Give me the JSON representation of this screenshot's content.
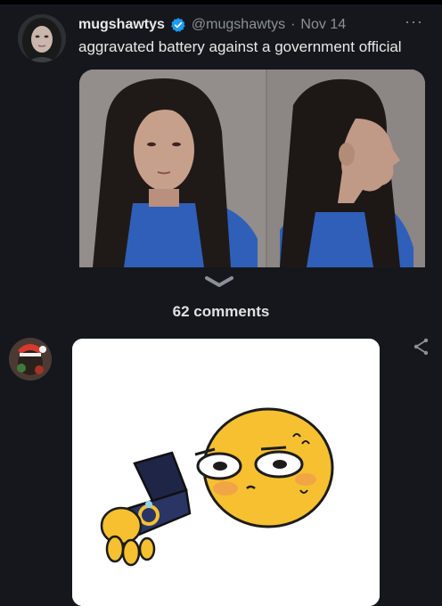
{
  "tweet": {
    "display_name": "mugshawtys",
    "handle": "@mugshawtys",
    "separator": "·",
    "date": "Nov 14",
    "text": "aggravated battery against a government official",
    "more_label": "···",
    "avatar_icon": "profile-photo",
    "verified_icon": "verified-badge-icon",
    "media_description_icon": "mugshot-photo"
  },
  "thread": {
    "expand_icon": "chevron-down-icon",
    "comments_label": "62 comments"
  },
  "comment": {
    "avatar_icon": "user-avatar",
    "share_icon": "share-icon",
    "image_icon": "emoji-ring-proposal-image"
  },
  "colors": {
    "background": "#15171c",
    "text": "#e7e9ea",
    "muted": "#8b9198",
    "verified": "#1d9bf0"
  }
}
